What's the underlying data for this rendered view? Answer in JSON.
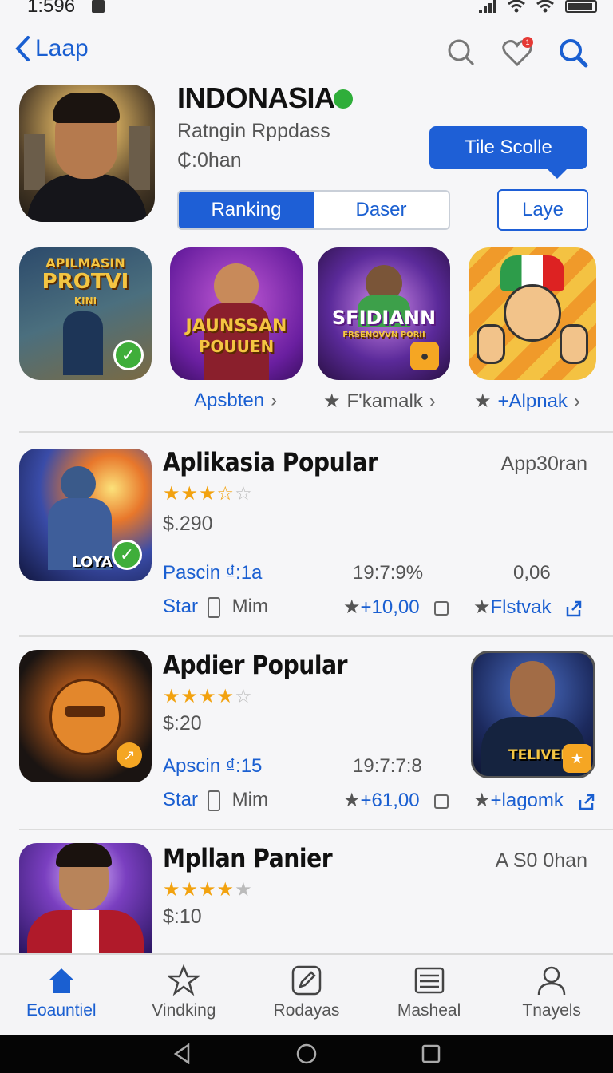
{
  "status_bar": {
    "time": "1:596"
  },
  "header": {
    "back_label": "Laap",
    "icons": [
      "search-outline-icon",
      "heart-icon",
      "search-icon"
    ],
    "heart_badge": "1"
  },
  "hero": {
    "title": "INDONASIA",
    "subtitle": "Ratngin Rppdass",
    "meta": "₵:0han",
    "segments": [
      "Ranking",
      "Daser"
    ],
    "tooltip": "Tile Scolle",
    "secondary_button": "Laye"
  },
  "featured": {
    "tiles": [
      {
        "art_text_1": "APILMASIN",
        "art_text_2": "PROTVI",
        "art_text_3": "KINI"
      },
      {
        "art_text_1": "JAUNSSAN",
        "art_text_2": "POUUEN"
      },
      {
        "art_text_1": "SFIDIANN",
        "art_text_2": "FRSENOVVN PORII"
      },
      {}
    ],
    "labels": [
      "Apsbten",
      "F'kamalk",
      "+Alpnak"
    ]
  },
  "apps": [
    {
      "title": "Aplikasia Popular",
      "rating": "★★★☆☆",
      "price": "$.290",
      "right_tag": "App30ran",
      "image_text": "LOYA'",
      "meta1": "Pascin ₫:1a",
      "meta2": "19:7:9%",
      "meta3": "0,06",
      "star_label": "Star",
      "mim_label": "Mim",
      "count": "+10,00",
      "link": "Flstvak"
    },
    {
      "title": "Apdier Popular",
      "rating": "★★★★☆",
      "price": "$:20",
      "right_tag": "",
      "side_image_text": "TELIVEK",
      "meta1": "Apscin ₫:15",
      "meta2": "19:7:7:8",
      "star_label": "Star",
      "mim_label": "Mim",
      "count": "+61,00",
      "link": "+lagomk"
    },
    {
      "title": "Mpllan Panier",
      "rating": "★★★★☆",
      "price": "$:10",
      "right_tag": "A S0 0han"
    }
  ],
  "tabs": [
    "Eoauntiel",
    "Vindking",
    "Rodayas",
    "Masheal",
    "Tnayels"
  ],
  "colors": {
    "accent": "#1e5fd6",
    "star": "#f2a20f",
    "verified": "#2fae3a"
  }
}
